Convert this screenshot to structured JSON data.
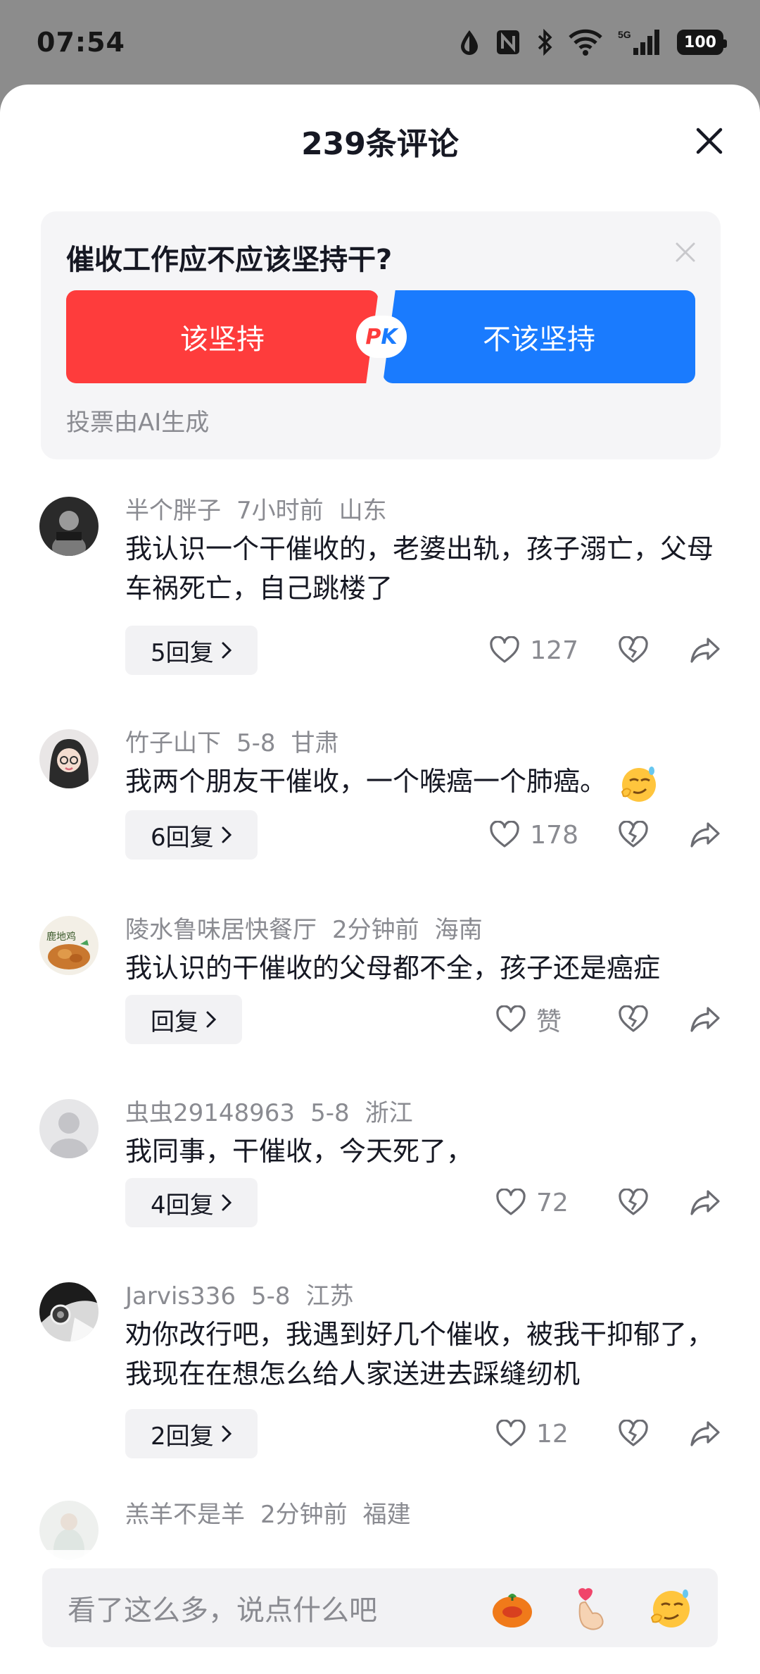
{
  "status_bar": {
    "time": "07:54",
    "battery": "100",
    "network": "5G"
  },
  "sheet": {
    "title": "239条评论"
  },
  "poll": {
    "question": "催收工作应不应该坚持干?",
    "option_yes": "该坚持",
    "option_no": "不该坚持",
    "pk_p": "P",
    "pk_k": "K",
    "note": "投票由AI生成"
  },
  "comments": [
    {
      "user": "半个胖子",
      "time": "7小时前",
      "location": "山东",
      "text": "我认识一个干催收的，老婆出轨，孩子溺亡，父母车祸死亡，自己跳楼了",
      "replies": "5回复",
      "likes": "127"
    },
    {
      "user": "竹子山下",
      "time": "5-8",
      "location": "甘肃",
      "text": "我两个朋友干催收，一个喉癌一个肺癌。",
      "replies": "6回复",
      "likes": "178"
    },
    {
      "user": "陵水鲁味居快餐厅",
      "time": "2分钟前",
      "location": "海南",
      "text": "我认识的干催收的父母都不全，孩子还是癌症",
      "replies": "回复",
      "likes": "赞"
    },
    {
      "user": "虫虫29148963",
      "time": "5-8",
      "location": "浙江",
      "text": "我同事，干催收，今天死了，",
      "replies": "4回复",
      "likes": "72"
    },
    {
      "user": "Jarvis336",
      "time": "5-8",
      "location": "江苏",
      "text": "劝你改行吧，我遇到好几个催收，被我干抑郁了，我现在在想怎么给人家送进去踩缝纫机",
      "replies": "2回复",
      "likes": "12"
    },
    {
      "user": "羔羊不是羊",
      "time": "2分钟前",
      "location": "福建"
    }
  ],
  "input": {
    "placeholder": "看了这么多，说点什么吧"
  },
  "avatar_text": "鹿地鸡",
  "colors": {
    "accent_red": "#fe3c3c",
    "accent_blue": "#1a7bfe",
    "secondary_text": "#8a8b91"
  }
}
